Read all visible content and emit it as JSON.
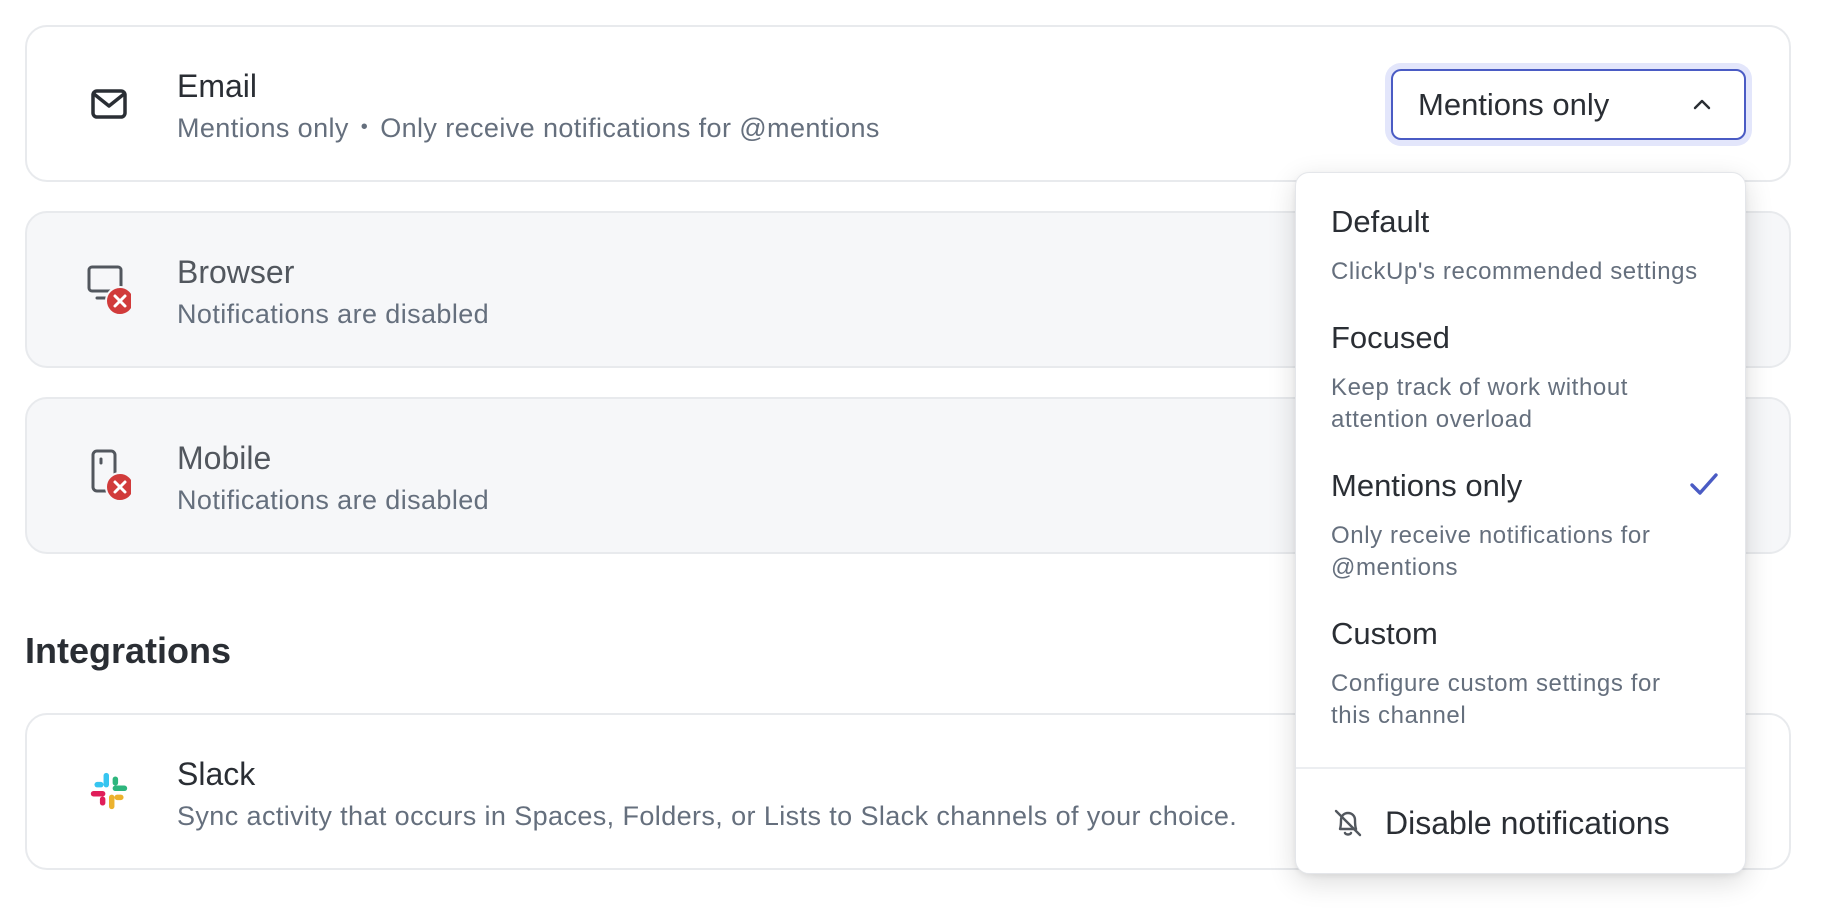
{
  "channels": [
    {
      "title": "Email",
      "subtitle_mode": "Mentions only",
      "subtitle_separator": "•",
      "subtitle_desc": "Only receive notifications for @mentions",
      "icon": "mail-icon"
    },
    {
      "title": "Browser",
      "subtitle": "Notifications are disabled",
      "icon": "monitor-icon"
    },
    {
      "title": "Mobile",
      "subtitle": "Notifications are disabled",
      "icon": "phone-icon"
    }
  ],
  "integrations": {
    "heading": "Integrations",
    "slack": {
      "title": "Slack",
      "subtitle": "Sync activity that occurs in Spaces, Folders, or Lists to Slack channels of your choice.",
      "icon": "slack-icon"
    }
  },
  "email_select": {
    "value": "Mentions only"
  },
  "dropdown": {
    "options": [
      {
        "label": "Default",
        "desc": "ClickUp's recommended settings",
        "selected": false
      },
      {
        "label": "Focused",
        "desc_line1": "Keep track of work without",
        "desc_line2": "attention overload",
        "selected": false
      },
      {
        "label": "Mentions only",
        "desc_line1": "Only receive notifications for",
        "desc_line2": "@mentions",
        "selected": true
      },
      {
        "label": "Custom",
        "desc_line1": "Configure custom settings for",
        "desc_line2": "this channel",
        "selected": false
      }
    ],
    "disable_label": "Disable notifications"
  },
  "colors": {
    "accent": "#4a5bc4",
    "error_badge": "#d13b3b",
    "disabled_card_bg": "#f6f7f9",
    "text_primary": "#2a2e34",
    "text_secondary": "#656f7d"
  }
}
